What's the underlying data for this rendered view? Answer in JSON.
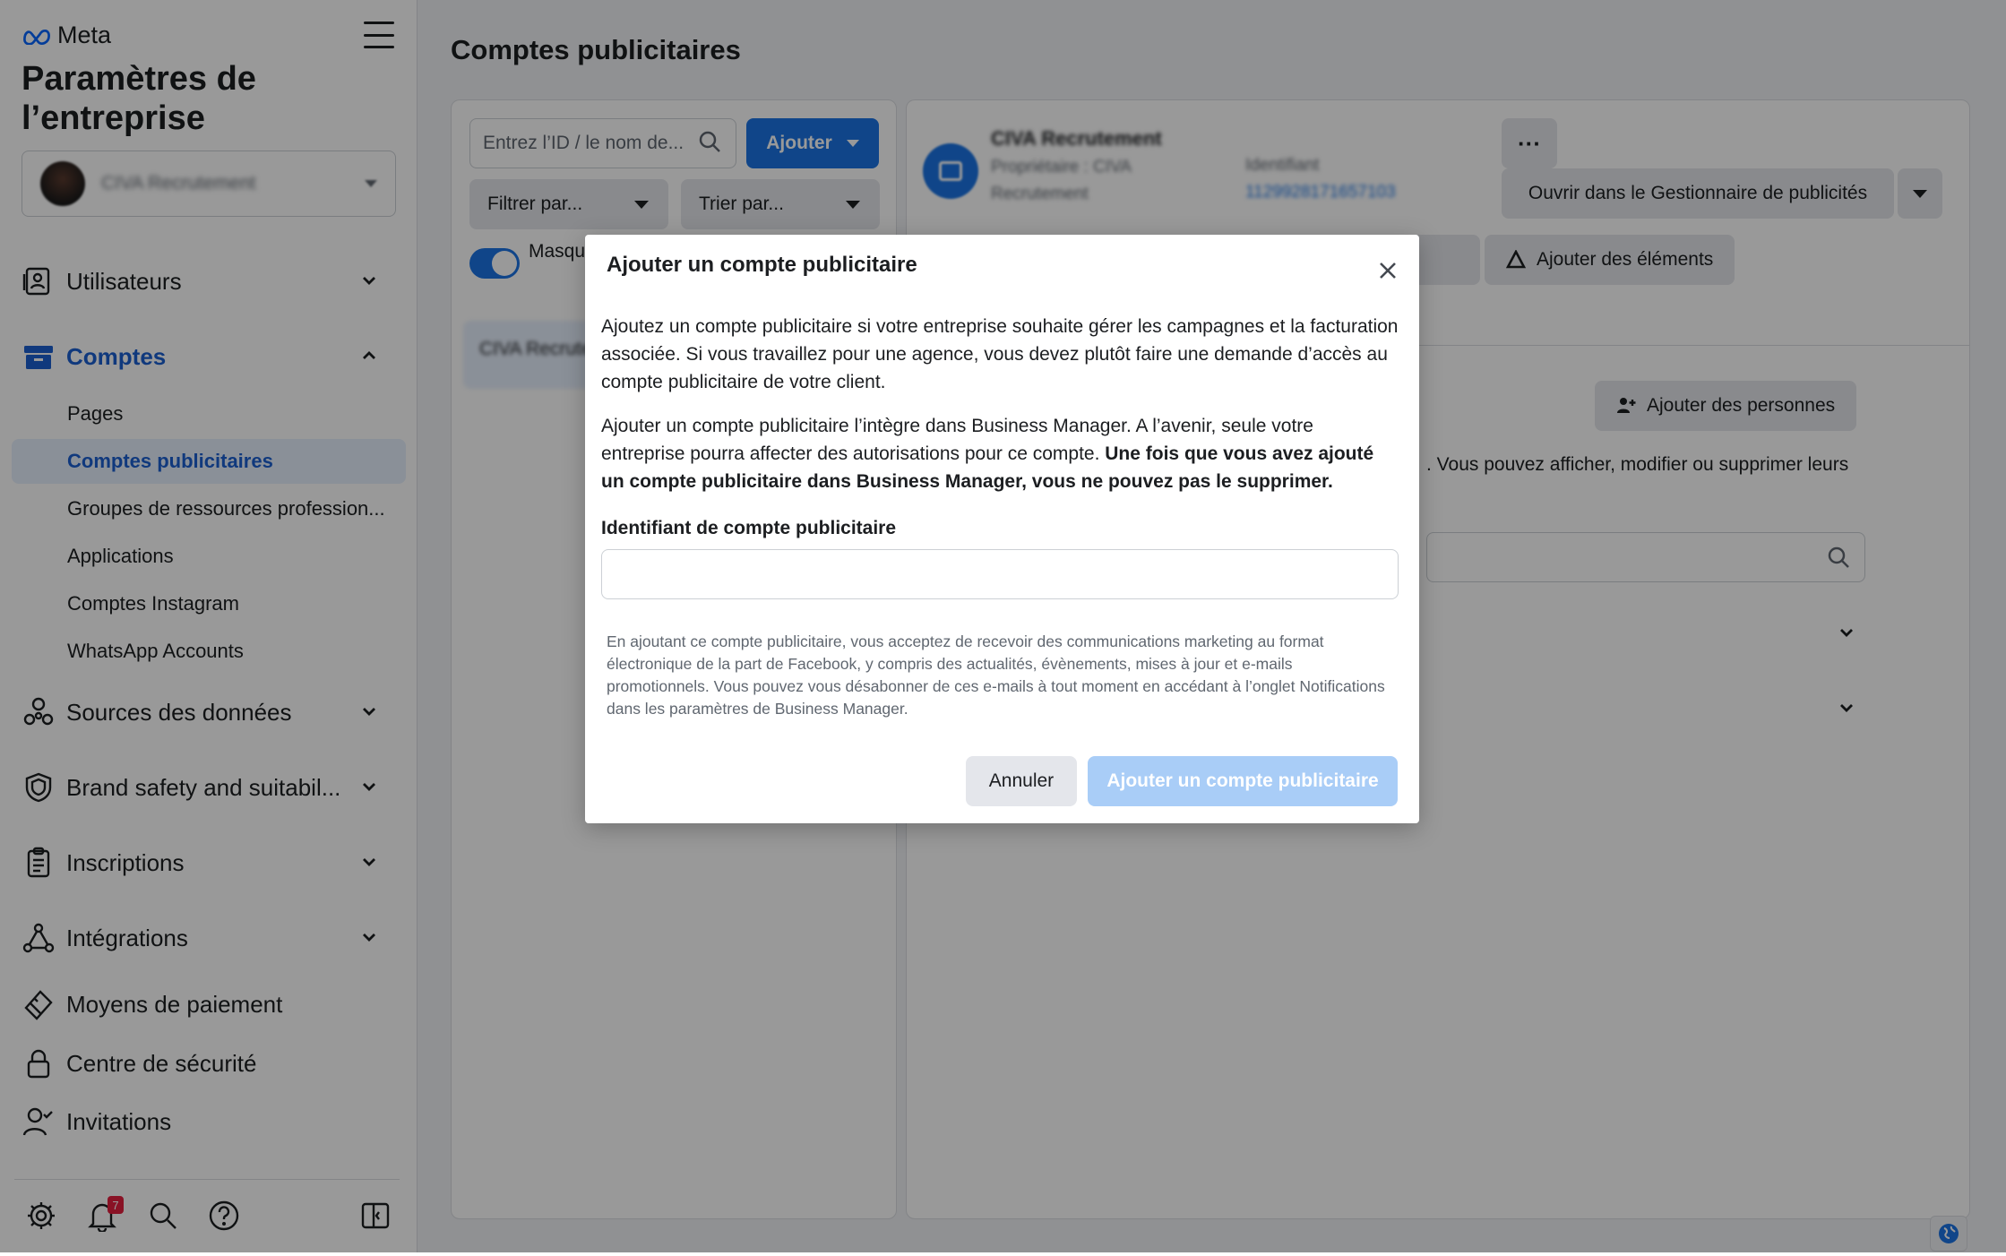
{
  "sidebar": {
    "brand": "Meta",
    "title": "Paramètres de l’entreprise",
    "business_name": "CIVA Recrutement",
    "nav": {
      "utilisateurs": "Utilisateurs",
      "comptes": "Comptes",
      "sources": "Sources des données",
      "brand_safety": "Brand safety and suitabil...",
      "inscriptions": "Inscriptions",
      "integrations": "Intégrations",
      "paiement": "Moyens de paiement",
      "securite": "Centre de sécurité",
      "invitations": "Invitations"
    },
    "sub_items": [
      "Pages",
      "Comptes publicitaires",
      "Groupes de ressources profession...",
      "Applications",
      "Comptes Instagram",
      "WhatsApp Accounts"
    ],
    "selected_sub_item": "Comptes publicitaires",
    "notification_count": "7"
  },
  "main": {
    "title": "Comptes publicitaires",
    "search_placeholder": "Entrez l’ID / le nom de...",
    "add_button": "Ajouter",
    "filter_label": "Filtrer par...",
    "sort_label": "Trier par...",
    "toggle_label": "Masquer les comptes fermés",
    "list_item": "CIVA Recrutement"
  },
  "detail": {
    "account_name": "CIVA Recrutement",
    "owner": "Propriétaire : CIVA Recrutement",
    "id_label": "Identifiant",
    "id_value": "1129928171657103",
    "more_label": "···",
    "open_button": "Ouvrir dans le Gestionnaire de publicités",
    "partners_button_partial": "ires",
    "add_elements_button": "Ajouter des éléments",
    "add_people_button": "Ajouter des personnes",
    "people_text": ". Vous pouvez afficher, modifier ou supprimer leurs"
  },
  "modal": {
    "title": "Ajouter un compte publicitaire",
    "p1": "Ajoutez un compte publicitaire si votre entreprise souhaite gérer les campagnes et la facturation associée. Si vous travaillez pour une agence, vous devez plutôt faire une demande d’accès au compte publicitaire de votre client.",
    "p2_normal": "Ajouter un compte publicitaire l’intègre dans Business Manager. A l’avenir, seule votre entreprise pourra affecter des autorisations pour ce compte. ",
    "p2_bold": "Une fois que vous avez ajouté un compte publicitaire dans Business Manager, vous ne pouvez pas le supprimer.",
    "field_label": "Identifiant de compte publicitaire",
    "field_value": "",
    "legal": "En ajoutant ce compte publicitaire, vous acceptez de recevoir des communications marketing au format électronique de la part de Facebook, y compris des actualités, évènements, mises à jour et e-mails promotionnels. Vous pouvez vous désabonner de ces e-mails à tout moment en accédant à l’onglet Notifications dans les paramètres de Business Manager.",
    "cancel": "Annuler",
    "submit": "Ajouter un compte publicitaire"
  },
  "colors": {
    "accent": "#1b74e4",
    "active_text": "#1b5fd1",
    "disabled_button": "#a9cdf7",
    "badge": "#e41e3f"
  }
}
